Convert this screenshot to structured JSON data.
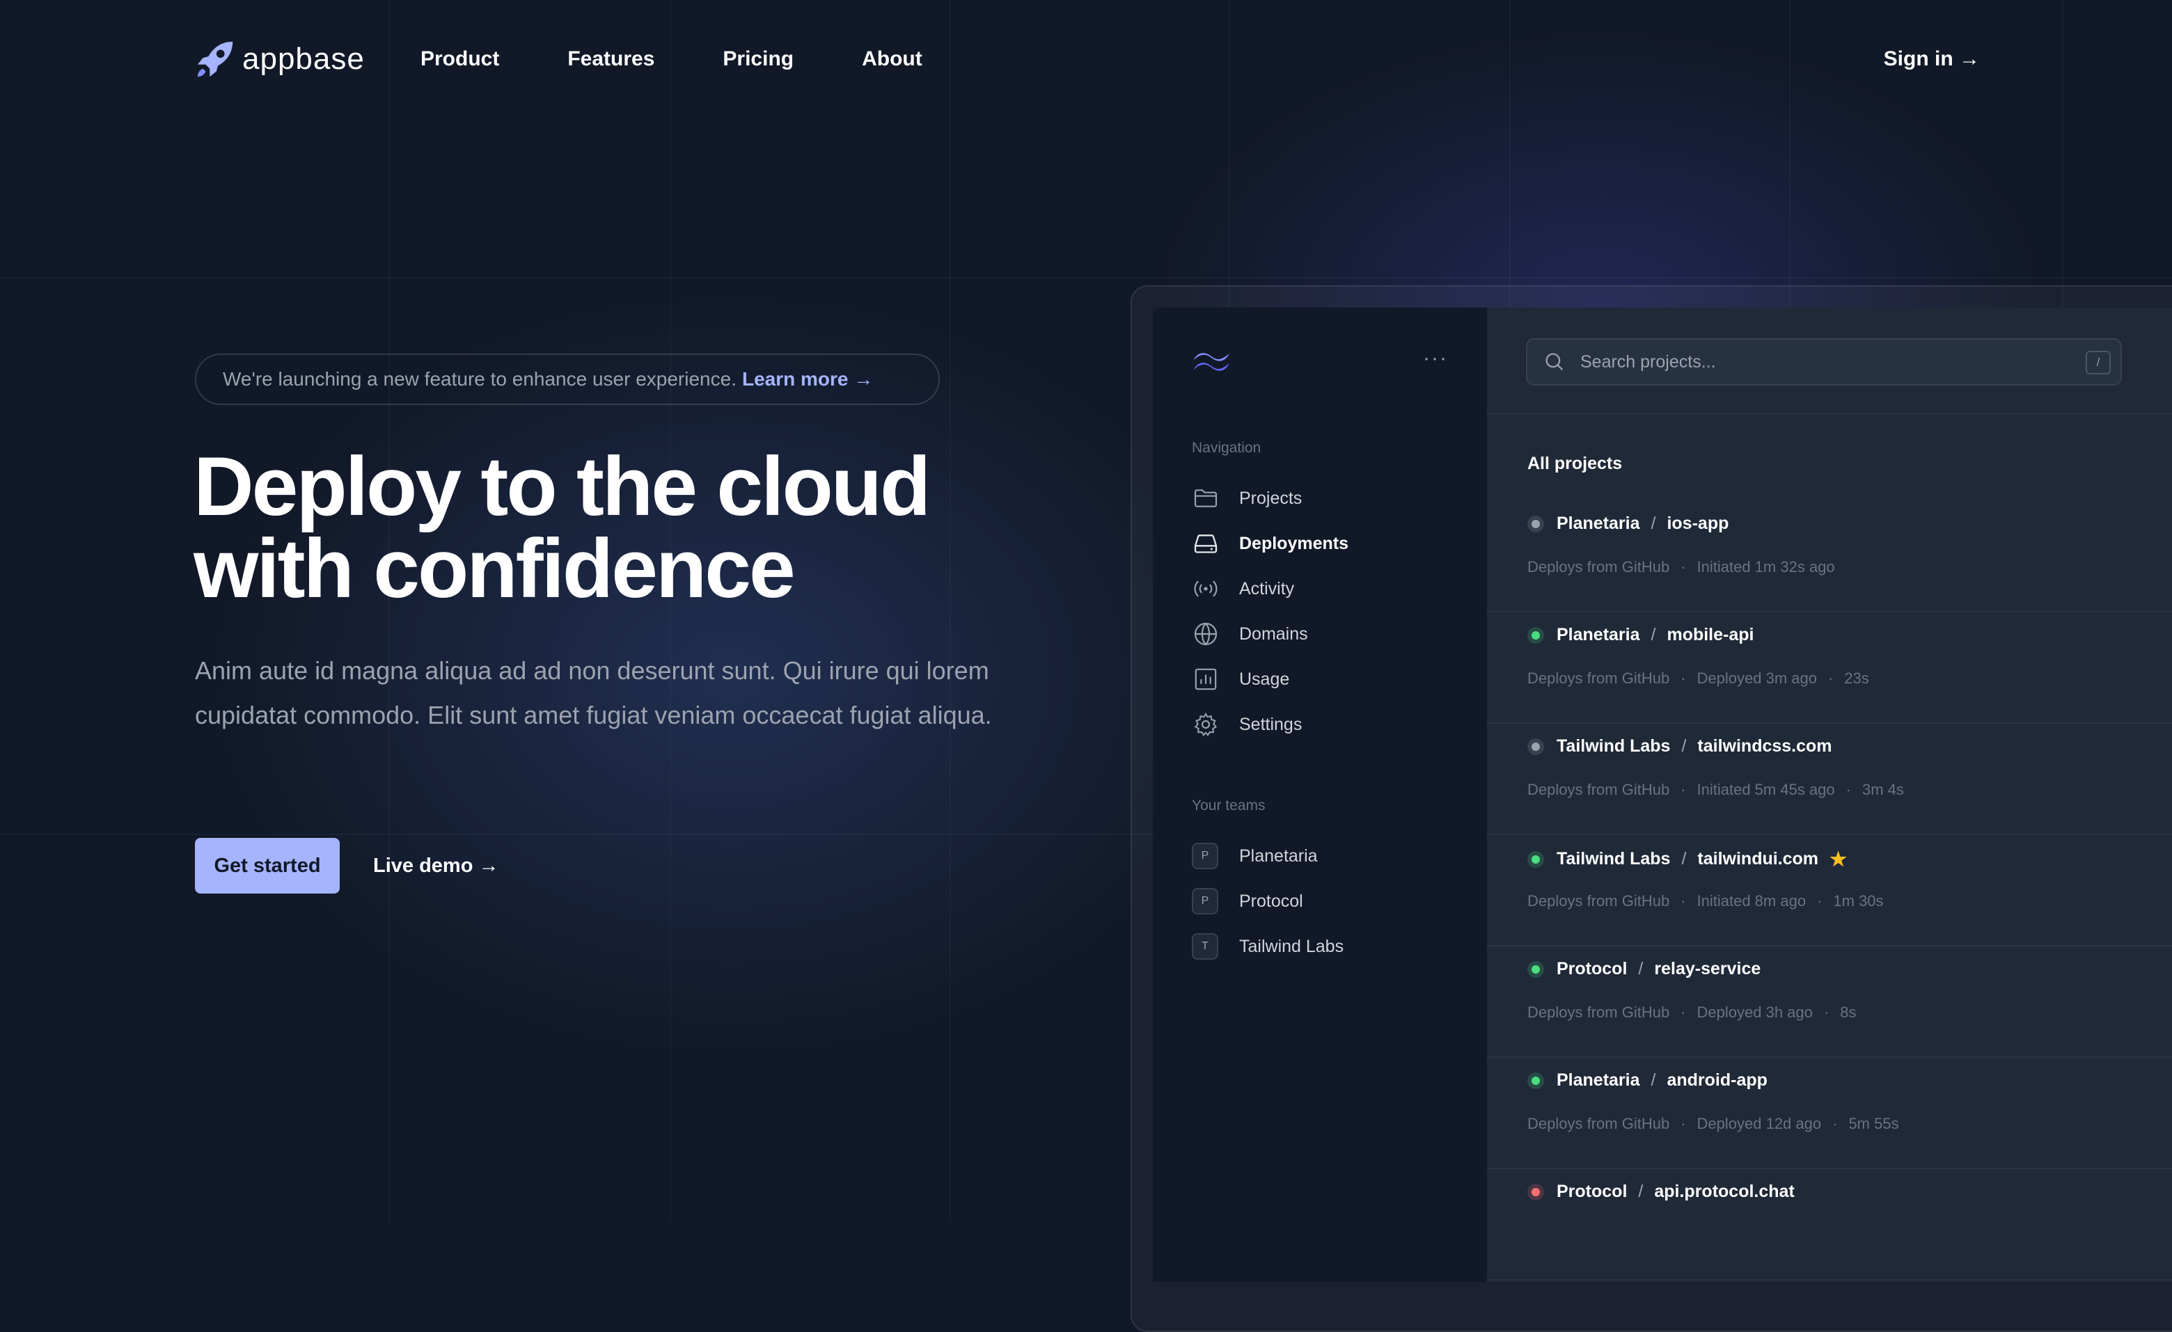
{
  "brand": {
    "name": "appbase"
  },
  "nav": {
    "items": [
      "Product",
      "Features",
      "Pricing",
      "About"
    ],
    "sign_in": "Sign in →"
  },
  "hero": {
    "banner_text": "We're launching a new feature to enhance user experience.",
    "banner_link": "Learn more →",
    "title_line1": "Deploy to the cloud",
    "title_line2": "with confidence",
    "description": "Anim aute id magna aliqua ad ad non deserunt sunt. Qui irure qui lorem cupidatat commodo. Elit sunt amet fugiat veniam occaecat fugiat aliqua.",
    "cta_primary": "Get started",
    "cta_secondary": "Live demo →"
  },
  "app": {
    "more_icon": "···",
    "sidebar": {
      "nav_heading": "Navigation",
      "items": [
        {
          "label": "Projects",
          "icon": "folder-icon"
        },
        {
          "label": "Deployments",
          "icon": "server-icon",
          "active": true
        },
        {
          "label": "Activity",
          "icon": "signal-icon"
        },
        {
          "label": "Domains",
          "icon": "globe-icon"
        },
        {
          "label": "Usage",
          "icon": "chart-bar-icon"
        },
        {
          "label": "Settings",
          "icon": "gear-icon"
        }
      ],
      "teams_heading": "Your teams",
      "teams": [
        {
          "initial": "P",
          "name": "Planetaria"
        },
        {
          "initial": "P",
          "name": "Protocol"
        },
        {
          "initial": "T",
          "name": "Tailwind Labs"
        }
      ]
    },
    "search": {
      "placeholder": "Search projects...",
      "shortcut": "/"
    },
    "list_title": "All projects",
    "separator": "/",
    "bullet": "·",
    "status_colors": {
      "green": "#4ade80",
      "gray": "#9ca3af",
      "red": "#f87171"
    },
    "projects": [
      {
        "team": "Planetaria",
        "name": "ios-app",
        "status": "gray",
        "source": "Deploys from GitHub",
        "state": "Initiated 1m 32s ago",
        "duration": "",
        "starred": false
      },
      {
        "team": "Planetaria",
        "name": "mobile-api",
        "status": "green",
        "source": "Deploys from GitHub",
        "state": "Deployed 3m ago",
        "duration": "23s",
        "starred": false
      },
      {
        "team": "Tailwind Labs",
        "name": "tailwindcss.com",
        "status": "gray",
        "source": "Deploys from GitHub",
        "state": "Initiated 5m 45s ago",
        "duration": "3m 4s",
        "starred": false
      },
      {
        "team": "Tailwind Labs",
        "name": "tailwindui.com",
        "status": "green",
        "source": "Deploys from GitHub",
        "state": "Initiated 8m ago",
        "duration": "1m 30s",
        "starred": true
      },
      {
        "team": "Protocol",
        "name": "relay-service",
        "status": "green",
        "source": "Deploys from GitHub",
        "state": "Deployed 3h ago",
        "duration": "8s",
        "starred": false
      },
      {
        "team": "Planetaria",
        "name": "android-app",
        "status": "green",
        "source": "Deploys from GitHub",
        "state": "Deployed 12d ago",
        "duration": "5m 55s",
        "starred": false
      },
      {
        "team": "Protocol",
        "name": "api.protocol.chat",
        "status": "red",
        "source": "",
        "state": "",
        "duration": "",
        "starred": false
      }
    ]
  }
}
